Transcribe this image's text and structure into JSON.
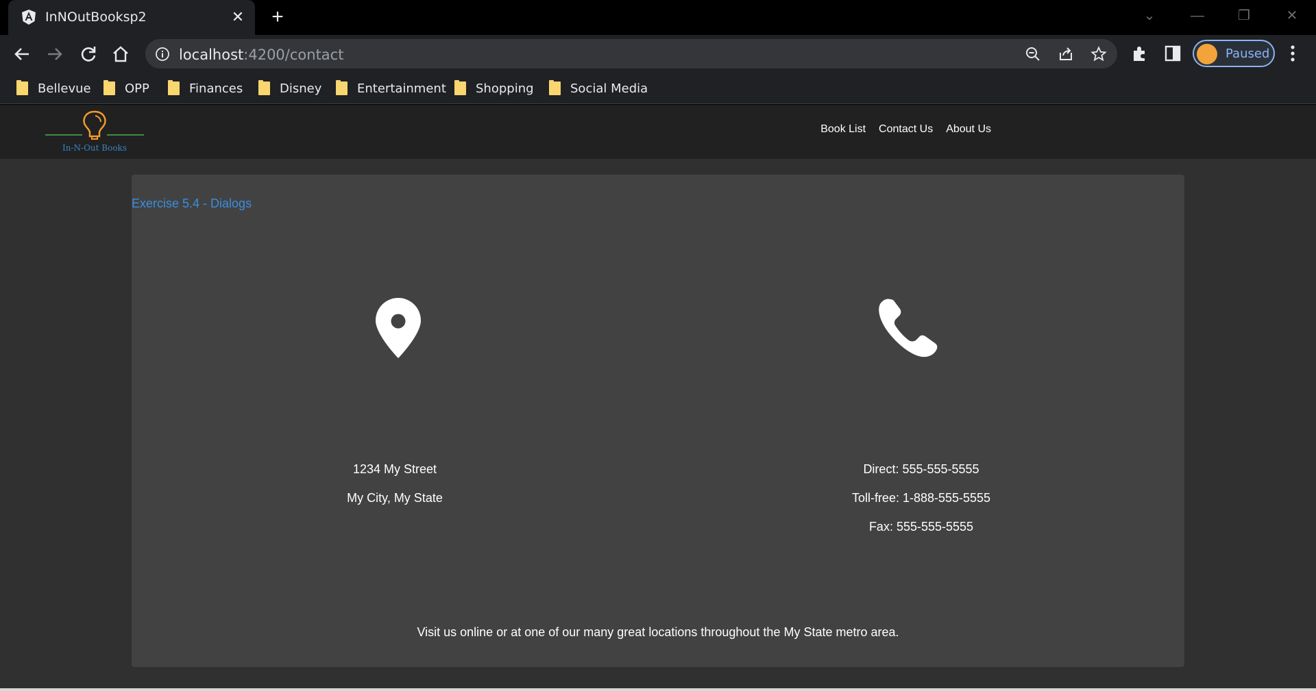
{
  "browser": {
    "tab_title": "InNOutBooksp2",
    "url_host": "localhost",
    "url_path": ":4200/contact",
    "profile_label": "Paused",
    "bookmarks": [
      "Bellevue",
      "OPP",
      "Finances",
      "Disney",
      "Entertainment",
      "Shopping",
      "Social Media"
    ]
  },
  "header": {
    "logo_text": "In-N-Out Books",
    "nav": [
      "Book List",
      "Contact Us",
      "About Us"
    ]
  },
  "card": {
    "title": "Exercise 5.4 - Dialogs",
    "address": {
      "icon": "map-pin-icon",
      "line1": "1234 My Street",
      "line2": "My City, My State"
    },
    "phone": {
      "icon": "phone-icon",
      "direct": "Direct: 555-555-5555",
      "tollfree": "Toll-free: 1-888-555-5555",
      "fax": "Fax: 555-555-5555"
    },
    "footer": "Visit us online or at one of our many great locations throughout the My State metro area."
  },
  "colors": {
    "accent": "#3b8ee0",
    "card_bg": "#424242",
    "header_bg": "#212121",
    "page_bg": "#303030"
  }
}
